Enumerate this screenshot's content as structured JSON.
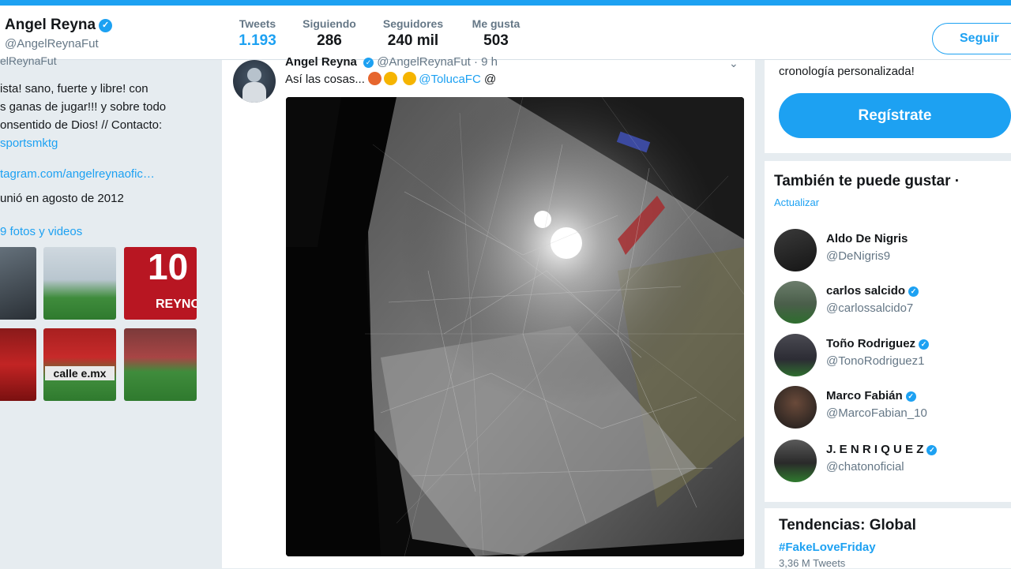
{
  "profile": {
    "name": "Angel Reyna",
    "handle": "@AngelReynaFut",
    "handle_partial": "elReynaFut"
  },
  "stats": [
    {
      "label": "Tweets",
      "value": "1.193"
    },
    {
      "label": "Siguiendo",
      "value": "286"
    },
    {
      "label": "Seguidores",
      "value": "240 mil"
    },
    {
      "label": "Me gusta",
      "value": "503"
    }
  ],
  "follow_button": "Seguir",
  "bio": {
    "lines": [
      "ista! sano, fuerte y libre! con",
      "s ganas de jugar!!! y sobre todo",
      "onsentido de Dios! // Contacto:"
    ],
    "contact_link": "sportsmktg",
    "website": "tagram.com/angelreynaofic…",
    "joined": "unió en agosto de 2012",
    "media_link": "9 fotos y videos"
  },
  "tweet": {
    "author": "Angel Reyna",
    "handle": "@AngelReynaFut",
    "time": "· 9 h",
    "text_start": "Así las cosas...",
    "mention": "@TolucaFC",
    "text_end": "@"
  },
  "sidebar": {
    "signup_text": "cronología personalizada!",
    "signup_button": "Regístrate",
    "wtf_title": "También te puede gustar",
    "wtf_dot": "·",
    "refresh": "Actualizar",
    "suggestions": [
      {
        "name": "Aldo De Nigris",
        "handle": "@DeNigris9",
        "verified": false
      },
      {
        "name": "carlos salcido",
        "handle": "@carlossalcido7",
        "verified": true
      },
      {
        "name": "Toño Rodriguez",
        "handle": "@TonoRodriguez1",
        "verified": true
      },
      {
        "name": "Marco Fabián",
        "handle": "@MarcoFabian_10",
        "verified": true
      },
      {
        "name": "J. E N R I Q U E Z",
        "handle": "@chatonoficial",
        "verified": true
      }
    ],
    "trends_title": "Tendencias: Global",
    "trend_tag": "#FakeLoveFriday",
    "trend_count": "3,36 M Tweets"
  },
  "thumbnails": {
    "jersey_number": "10",
    "jersey_name": "REYNO",
    "banner_text": "calle e.mx"
  },
  "colors": {
    "accent": "#1da1f2",
    "text": "#14171a",
    "muted": "#657786",
    "background": "#e6ecf0"
  }
}
